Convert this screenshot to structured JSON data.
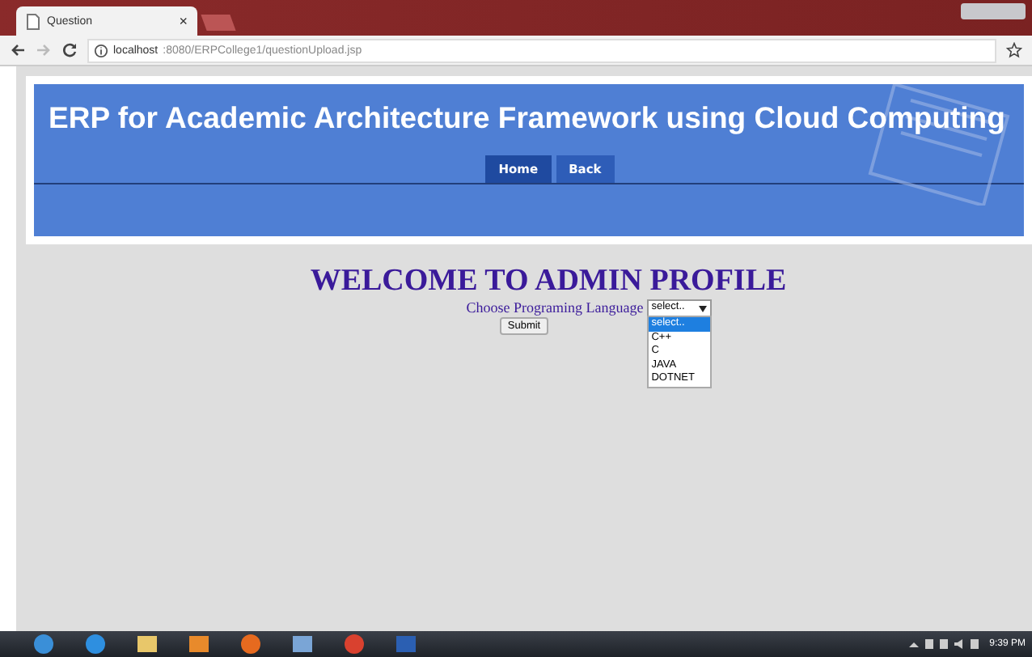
{
  "browser": {
    "tab_title": "Question",
    "tab_close": "×",
    "url_host": "localhost",
    "url_path": ":8080/ERPCollege1/questionUpload.jsp"
  },
  "header": {
    "title": "ERP for Academic Architecture Framework using Cloud Computing",
    "nav": [
      {
        "label": "Home",
        "selected": true
      },
      {
        "label": "Back",
        "selected": false
      }
    ]
  },
  "main": {
    "heading": "WELCOME TO ADMIN PROFILE",
    "label": "Choose Programing Language",
    "select_value": "select..",
    "options": [
      {
        "label": "select..",
        "selected": true
      },
      {
        "label": "C++",
        "selected": false
      },
      {
        "label": "C",
        "selected": false
      },
      {
        "label": "JAVA",
        "selected": false
      },
      {
        "label": "DOTNET",
        "selected": false
      }
    ],
    "submit": "Submit"
  },
  "taskbar": {
    "clock": "9:39 PM"
  }
}
